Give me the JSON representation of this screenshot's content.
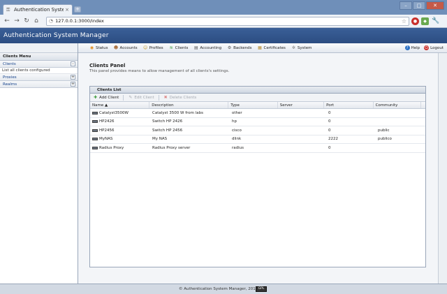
{
  "browser": {
    "tab_title": "Authentication Syste...",
    "tab_close": "×",
    "new_tab": "+",
    "url": "127.0.0.1:3000/index",
    "win_min": "–",
    "win_max": "□",
    "win_close": "✕"
  },
  "app": {
    "title": "Authentication System Manager"
  },
  "menu": {
    "items": [
      {
        "label": "Status",
        "icon": "status-icon"
      },
      {
        "label": "Accounts",
        "icon": "accounts-icon"
      },
      {
        "label": "Profiles",
        "icon": "profiles-icon"
      },
      {
        "label": "Clients",
        "icon": "clients-icon"
      },
      {
        "label": "Accounting",
        "icon": "accounting-icon"
      },
      {
        "label": "Backends",
        "icon": "backends-icon"
      },
      {
        "label": "Certificates",
        "icon": "certificates-icon"
      },
      {
        "label": "System",
        "icon": "system-icon"
      }
    ],
    "help": "Help",
    "logout": "Logout"
  },
  "sidebar": {
    "header": "Clients Menu",
    "items": [
      {
        "label": "Clients",
        "toggle": "–",
        "expanded": true,
        "sub": "List all clients configured"
      },
      {
        "label": "Proxies",
        "toggle": "+"
      },
      {
        "label": "Realms",
        "toggle": "+"
      }
    ]
  },
  "main": {
    "title": "Clients Panel",
    "description": "This panel provides means to allow management of all clients's settings."
  },
  "grid": {
    "title": "Clients List",
    "toolbar": {
      "add": "Add Client",
      "edit": "Edit Client",
      "delete": "Delete Clients"
    },
    "columns": [
      "Name ▲",
      "Description",
      "Type",
      "Server",
      "Port",
      "Community"
    ],
    "rows": [
      [
        "Catalyst3500W",
        "Catalyst 3500 W from labs",
        "other",
        "",
        "0",
        ""
      ],
      [
        "HP2426",
        "Switch HP 2426",
        "hp",
        "",
        "0",
        ""
      ],
      [
        "HP2456",
        "Switch HP 2456",
        "cisco",
        "",
        "0",
        "public"
      ],
      [
        "MyNAS",
        "My NAS",
        "dlink",
        "",
        "2222",
        "publico"
      ],
      [
        "Radius Proxy",
        "Radius Proxy server",
        "radius",
        "",
        "0",
        ""
      ]
    ]
  },
  "footer": {
    "text": "© Authentication System Manager, 2011",
    "badge": "GPL"
  },
  "colors": {
    "header": "#2c4d82",
    "accent": "#15428b"
  }
}
